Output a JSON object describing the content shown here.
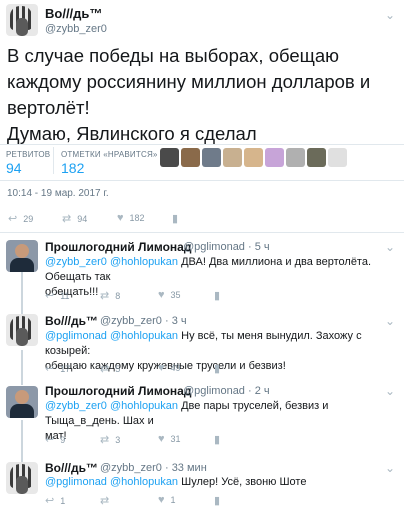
{
  "main_tweet": {
    "author_name": "Во///дь™",
    "author_handle": "@zybb_zer0",
    "text_line1": "В случае победы на выборах, обещаю",
    "text_line2": "каждому россиянину миллион долларов и",
    "text_line3": "вертолёт!",
    "text_line4": "Думаю, Явлинского я сделал",
    "retweets_label": "РЕТВИТОВ",
    "retweets_count": "94",
    "likes_label": "ОТМЕТКИ «НРАВИТСЯ»",
    "likes_count": "182",
    "timestamp": "10:14 - 19 мар. 2017 г.",
    "actions": {
      "replies": "29",
      "retweets": "94",
      "likes": "182"
    }
  },
  "replies": [
    {
      "name": "Прошлогодний Лимонад",
      "handle": "@pglimonad · 5 ч",
      "mention1": "@zybb_zer0",
      "mention2": "@hohlopukan",
      "line1": "ДВА! Два миллиона и два вертолёта. Обещать так",
      "line2": "обещать!!!",
      "actions": {
        "replies": "11",
        "retweets": "8",
        "likes": "35"
      }
    },
    {
      "name": "Во///дь™",
      "handle": "@zybb_zer0 · 3 ч",
      "mention1": "@pglimonad",
      "mention2": "@hohlopukan",
      "line1": "Ну всё, ты меня вынудил. Захожу с козырей:",
      "line2": "обещаю каждому кружевные трусели и безвиз!",
      "actions": {
        "replies": "17",
        "retweets": "5",
        "likes": "49"
      }
    },
    {
      "name": "Прошлогодний Лимонад",
      "handle": "@pglimonad · 2 ч",
      "mention1": "@zybb_zer0",
      "mention2": "@hohlopukan",
      "line1": "Две пары труселей, безвиз и Тыща_в_день. Шах и",
      "line2": "мат!",
      "actions": {
        "replies": "9",
        "retweets": "3",
        "likes": "31"
      }
    },
    {
      "name": "Во///дь™",
      "handle": "@zybb_zer0 · 33 мин",
      "mention1": "@pglimonad",
      "mention2": "@hohlopukan",
      "line1": "Шулер! Усё, звоню Шоте",
      "line2": "",
      "actions": {
        "replies": "1",
        "retweets": "",
        "likes": "1"
      }
    }
  ],
  "icons": {
    "reply": "reply-icon",
    "retweet": "retweet-icon",
    "like": "heart-icon",
    "analytics": "analytics-icon",
    "more": "chevron-down-icon"
  },
  "colors": {
    "link": "#1da1f2",
    "secondary": "#657786",
    "text": "#14171a"
  }
}
